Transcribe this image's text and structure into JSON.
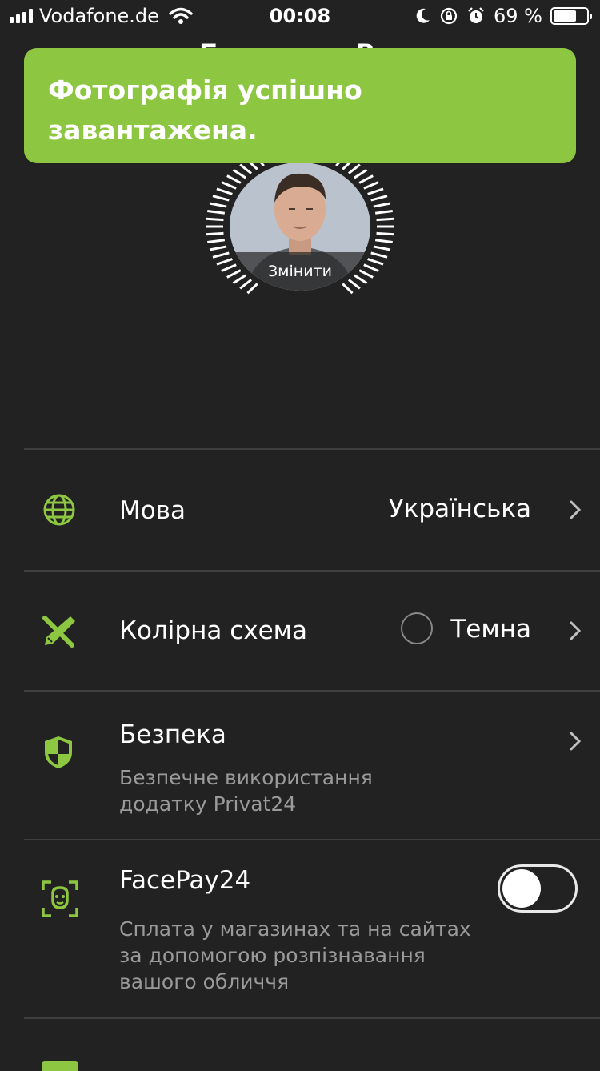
{
  "status_bar": {
    "carrier": "Vodafone.de",
    "time": "00:08",
    "battery_percent": "69 %",
    "battery_level": 0.69
  },
  "header": {
    "title": "Б…………… В…"
  },
  "toast": {
    "message": "Фотографія успішно завантажена."
  },
  "avatar": {
    "change_label": "Змінити"
  },
  "settings": {
    "language": {
      "title": "Мова",
      "value": "Українська"
    },
    "color_scheme": {
      "title": "Колірна схема",
      "value": "Темна"
    },
    "security": {
      "title": "Безпека",
      "subtitle_line1": "Безпечне використання",
      "subtitle_line2": "додатку Privat24"
    },
    "facepay": {
      "title": "FacePay24",
      "subtitle_line1": "Сплата у магазинах та на сайтах",
      "subtitle_line2": "за допомогою розпізнавання",
      "subtitle_line3": "вашого обличчя",
      "enabled": false
    }
  },
  "colors": {
    "accent": "#8dc641",
    "background": "#222222",
    "divider": "#3f3f3f",
    "secondary_text": "#9a9a9a"
  },
  "icons": [
    "signal-icon",
    "wifi-icon",
    "moon-icon",
    "rotation-lock-icon",
    "alarm-icon",
    "battery-icon",
    "globe-icon",
    "pencil-ruler-icon",
    "shield-icon",
    "face-scan-icon",
    "chevron-right-icon"
  ]
}
